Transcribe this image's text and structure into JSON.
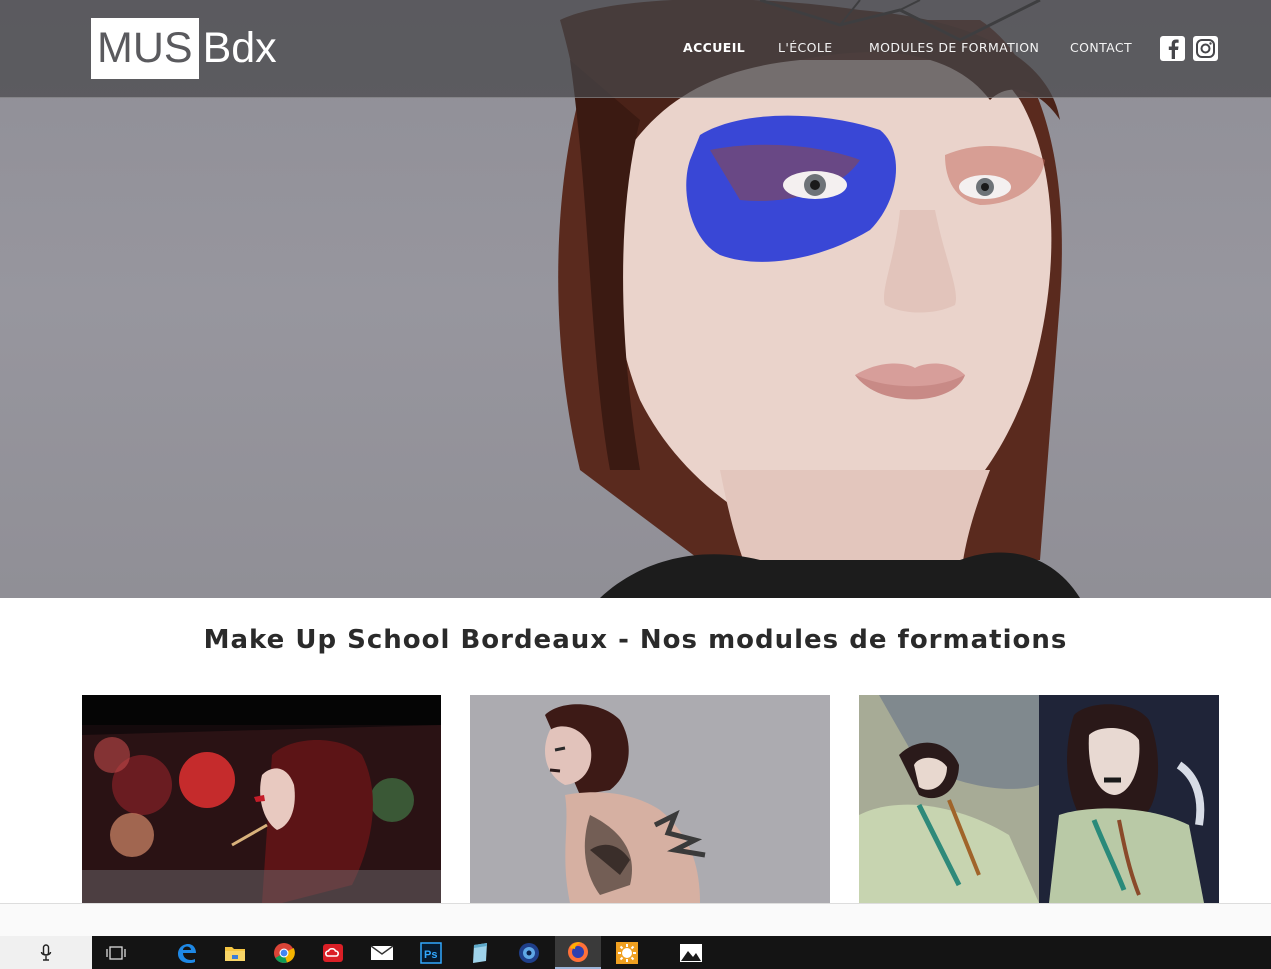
{
  "site": {
    "logo_boxed": "MUS",
    "logo_rest": "Bdx"
  },
  "nav": {
    "items": [
      {
        "label": "ACCUEIL",
        "active": true
      },
      {
        "label": "L'ÉCOLE",
        "active": false
      },
      {
        "label": "MODULES DE FORMATION",
        "active": false
      },
      {
        "label": "CONTACT",
        "active": false
      }
    ],
    "social": [
      "facebook-icon",
      "instagram-icon"
    ]
  },
  "main": {
    "section_title": "Make Up School Bordeaux - Nos modules de formations",
    "cards": [
      {
        "image": "woman-in-car-applying-lipstick"
      },
      {
        "image": "woman-with-body-paint"
      },
      {
        "image": "two-women-with-dark-lipstick"
      }
    ]
  },
  "taskbar": {
    "apps": [
      "microphone-icon",
      "task-view-icon",
      "edge-icon",
      "file-explorer-icon",
      "chrome-icon",
      "creative-cloud-icon",
      "mail-icon",
      "photoshop-icon",
      "notepad-icon",
      "app-circle-icon",
      "firefox-icon",
      "sun-settings-icon",
      "photos-icon"
    ],
    "active": "firefox-icon"
  },
  "colors": {
    "topbar": "#46464a",
    "hero_bg": "#97969e",
    "makeup_blue": "#2f3fd6",
    "taskbar": "#141414"
  }
}
